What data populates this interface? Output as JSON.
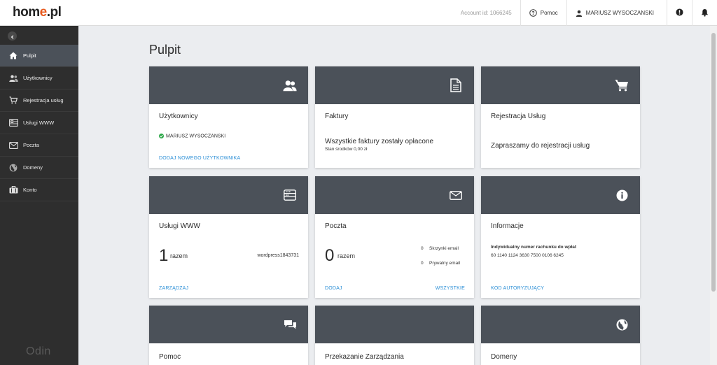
{
  "header": {
    "logo_main": "hom",
    "logo_accent": "e",
    "logo_suffix": ".pl",
    "account_id": "Account id: 1066245",
    "help_label": "Pomoc",
    "user_name": "MARIUSZ WYSOCZANSKI"
  },
  "sidebar": {
    "items": [
      {
        "label": "Pulpit",
        "icon": "home-icon"
      },
      {
        "label": "Użytkownicy",
        "icon": "users-icon"
      },
      {
        "label": "Rejestracja usług",
        "icon": "cart-icon"
      },
      {
        "label": "Usługi WWW",
        "icon": "server-icon"
      },
      {
        "label": "Poczta",
        "icon": "mail-icon"
      },
      {
        "label": "Domeny",
        "icon": "globe-icon"
      },
      {
        "label": "Konto",
        "icon": "briefcase-icon"
      }
    ],
    "brand": "Odin"
  },
  "main": {
    "title": "Pulpit",
    "cards": {
      "users": {
        "title": "Użytkownicy",
        "user": "MARIUSZ WYSOCZANSKI",
        "link": "DODAJ NOWEGO UŻYTKOWNIKA"
      },
      "invoices": {
        "title": "Faktury",
        "status": "Wszystkie faktury zostały opłacone",
        "balance": "Stan środków 0,00 zł"
      },
      "registration": {
        "title": "Rejestracja Usług",
        "text": "Zapraszamy do rejestracji usług"
      },
      "www": {
        "title": "Usługi WWW",
        "count": "1",
        "count_label": "razem",
        "site": "wordpress1843731",
        "link": "ZARZĄDZAJ"
      },
      "mail": {
        "title": "Poczta",
        "count": "0",
        "count_label": "razem",
        "mailbox_count": "0",
        "mailbox_label": "Skrzynki email",
        "private_count": "0",
        "private_label": "Prywatny email",
        "link_add": "DODAJ",
        "link_all": "WSZYSTKIE"
      },
      "info": {
        "title": "Informacje",
        "account_label": "Indywidualny numer rachunku do wpłat",
        "account_number": "60 1140 1124 3630 7500 0106 6245",
        "link": "KOD AUTORYZUJĄCY"
      },
      "help": {
        "title": "Pomoc"
      },
      "transfer": {
        "title": "Przekazanie Zarządzania"
      },
      "domains": {
        "title": "Domeny"
      }
    }
  },
  "colors": {
    "header_bg": "#4b5159",
    "link": "#2c8fd6",
    "sidebar_bg": "#2e2e2e",
    "accent": "#e85a1e",
    "success": "#2ea84a"
  }
}
